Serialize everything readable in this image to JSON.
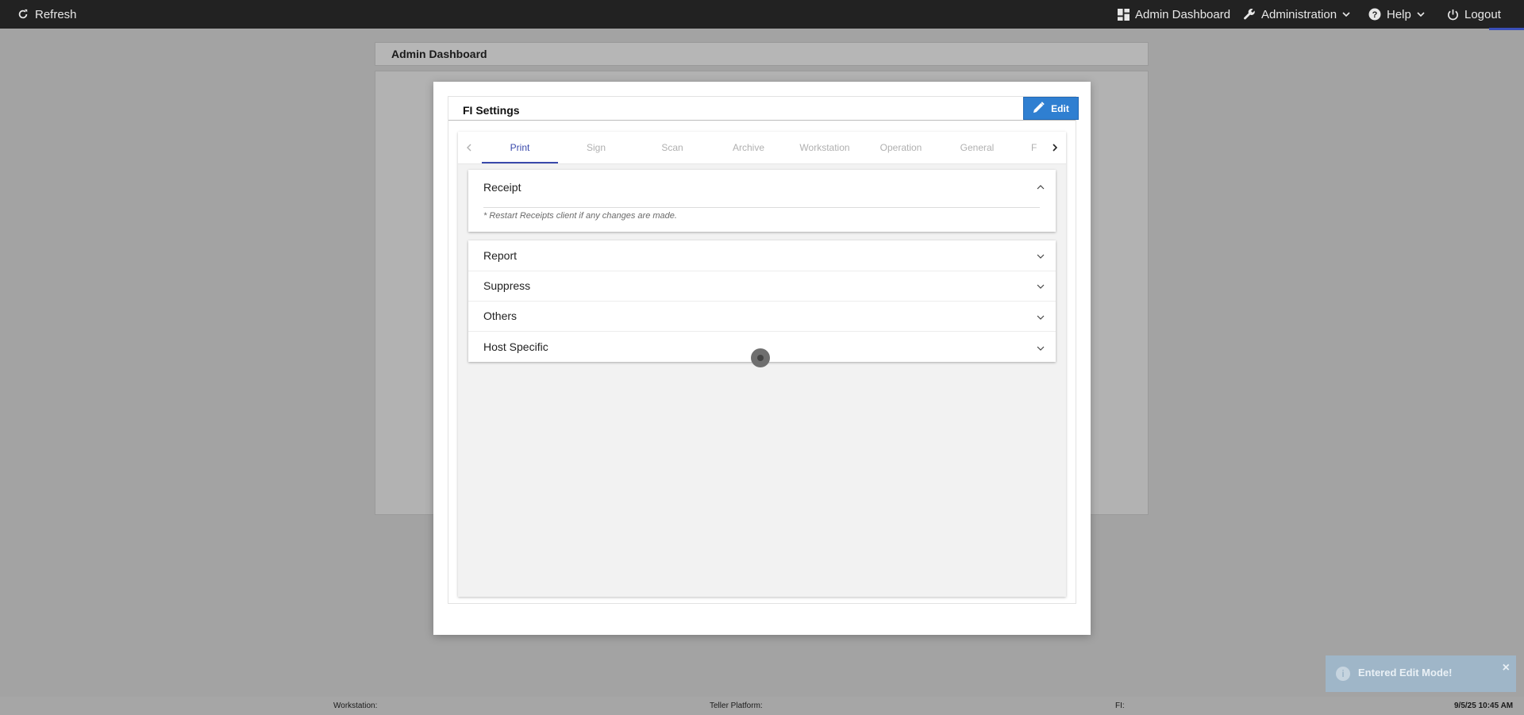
{
  "topbar": {
    "refresh_label": "Refresh",
    "admin_dashboard_label": "Admin Dashboard",
    "administration_label": "Administration",
    "help_label": "Help",
    "logout_label": "Logout"
  },
  "page": {
    "card_title": "Admin Dashboard"
  },
  "modal": {
    "title": "FI Settings",
    "edit_label": "Edit",
    "tabs": [
      {
        "label": "Print",
        "active": true
      },
      {
        "label": "Sign",
        "active": false
      },
      {
        "label": "Scan",
        "active": false
      },
      {
        "label": "Archive",
        "active": false
      },
      {
        "label": "Workstation",
        "active": false
      },
      {
        "label": "Operation",
        "active": false
      },
      {
        "label": "General",
        "active": false
      },
      {
        "label": "F",
        "active": false
      }
    ],
    "sections": {
      "receipt": {
        "title": "Receipt",
        "note": "* Restart Receipts client if any changes are made."
      },
      "report": {
        "title": "Report"
      },
      "suppress": {
        "title": "Suppress"
      },
      "others": {
        "title": "Others"
      },
      "host_specific": {
        "title": "Host Specific"
      }
    }
  },
  "toast": {
    "message": "Entered Edit Mode!",
    "close": "×"
  },
  "footer": {
    "workstation_label": "Workstation:",
    "teller_platform_label": "Teller Platform:",
    "fi_label": "FI:",
    "datetime": "9/5/25 10:45 AM"
  },
  "colors": {
    "primary": "#2f7fd1",
    "tab_active": "#3949ab",
    "topbar": "#222222",
    "toast": "#9fb6c8"
  }
}
